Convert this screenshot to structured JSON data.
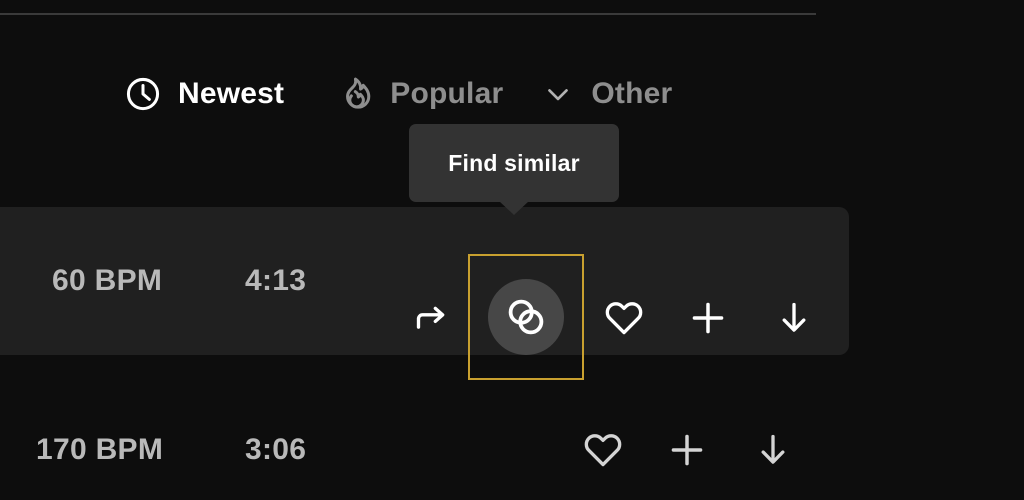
{
  "theme": {
    "page_background": "#0d0d0d",
    "row_hover_background": "#202020",
    "tooltip_background": "#333333",
    "focus_outline": "#c8a02f",
    "icon_hover_circle": "#474747",
    "text_primary": "#ffffff",
    "text_muted": "#8e8e8e",
    "text_meta": "#b9b9b9",
    "divider": "#3a3a3a"
  },
  "sortbar": {
    "items": [
      {
        "label": "Newest",
        "icon": "clock-icon",
        "state": "active"
      },
      {
        "label": "Popular",
        "icon": "flame-icon",
        "state": "inactive"
      },
      {
        "label": "Other",
        "icon": "chevron-down-icon",
        "state": "inactive"
      }
    ]
  },
  "tooltip": {
    "label": "Find similar",
    "visible": true,
    "attached_to": "find-similar-button"
  },
  "tracks": [
    {
      "bpm": "60 BPM",
      "duration": "4:13",
      "hovered": true,
      "actions": [
        {
          "name": "share-icon",
          "label": "Share"
        },
        {
          "name": "find-similar-icon",
          "label": "Find similar"
        },
        {
          "name": "heart-icon",
          "label": "Like"
        },
        {
          "name": "plus-icon",
          "label": "Add"
        },
        {
          "name": "download-icon",
          "label": "Download"
        }
      ]
    },
    {
      "bpm": "170 BPM",
      "duration": "3:06",
      "hovered": false,
      "actions": [
        {
          "name": "heart-icon",
          "label": "Like"
        },
        {
          "name": "plus-icon",
          "label": "Add"
        },
        {
          "name": "download-icon",
          "label": "Download"
        }
      ]
    }
  ]
}
